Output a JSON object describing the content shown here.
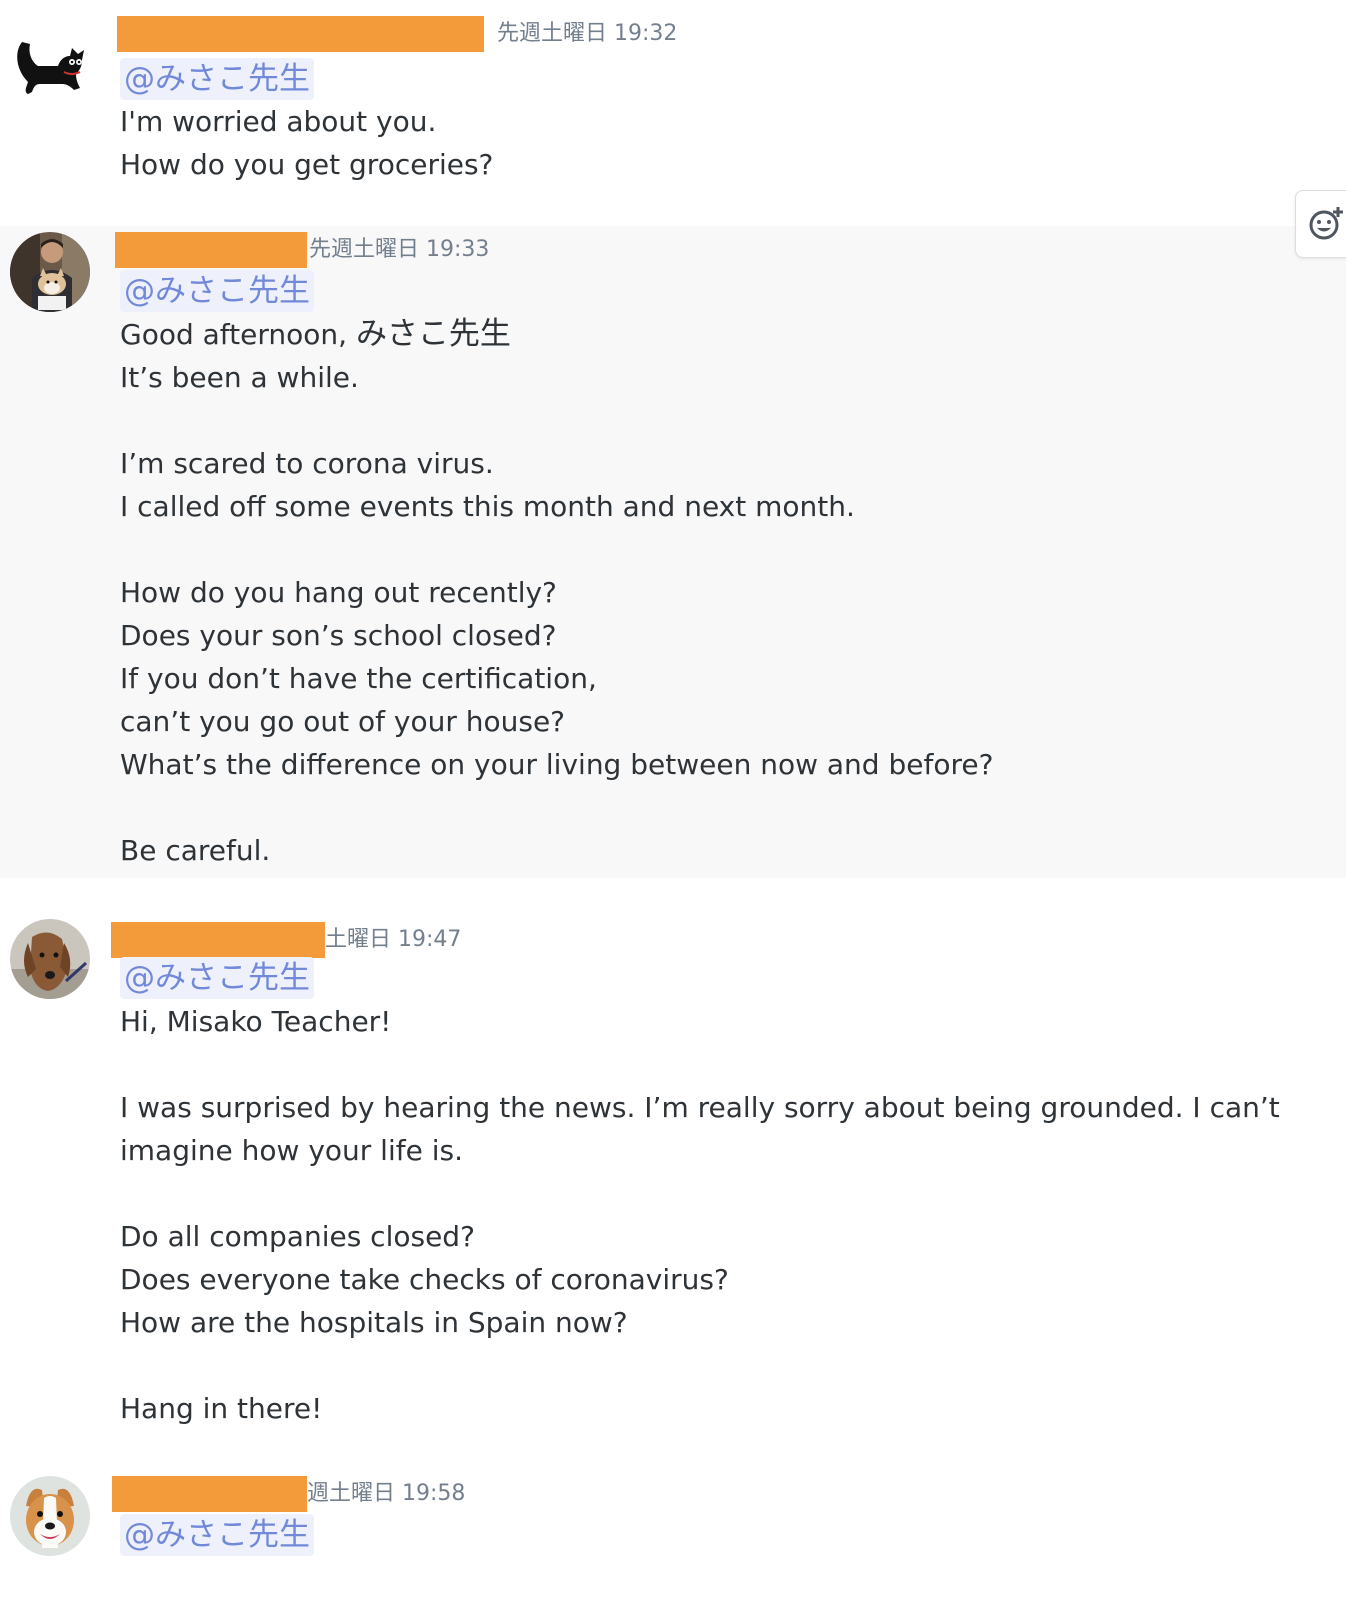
{
  "mention_text": "@みさこ先生",
  "messages": [
    {
      "timestamp": "先週土曜日 19:32",
      "lines": [
        "I'm worried about you.",
        "How do you get groceries?"
      ]
    },
    {
      "timestamp": "先週土曜日 19:33",
      "greeting_prefix": "Good afternoon, ",
      "greeting_name": "みさこ先生",
      "lines": [
        "It’s been a while.",
        "",
        "I’m scared to corona virus.",
        "I called off some events this month and next month.",
        "",
        "How do you hang out recently?",
        "Does your son’s school closed?",
        "If you don’t have the certification,",
        "can’t you go out of your house?",
        "What’s the difference on your living between now and before?",
        "",
        "Be careful."
      ]
    },
    {
      "timestamp": "土曜日 19:47",
      "lines": [
        "Hi, Misako Teacher!",
        "",
        "I was surprised by hearing the news. I’m really sorry about being grounded. I can’t imagine how your life is.",
        "",
        "Do all companies closed?",
        "Does everyone take checks of coronavirus?",
        "How are the hospitals in Spain now?",
        "",
        "Hang in there!"
      ]
    },
    {
      "timestamp": "週土曜日 19:58"
    }
  ],
  "icons": {
    "reaction": "add-reaction-icon",
    "avatar_1": "black-cat-avatar",
    "avatar_2": "man-with-dog-avatar",
    "avatar_3": "dachshund-avatar",
    "avatar_4": "smiling-dog-avatar"
  },
  "colors": {
    "redaction": "#f39a3a",
    "mention_text": "#7289da",
    "mention_background": "#eef1fb",
    "highlight_background": "#f8f8f9",
    "timestamp": "#747f8d",
    "message_text": "#2e3338"
  }
}
